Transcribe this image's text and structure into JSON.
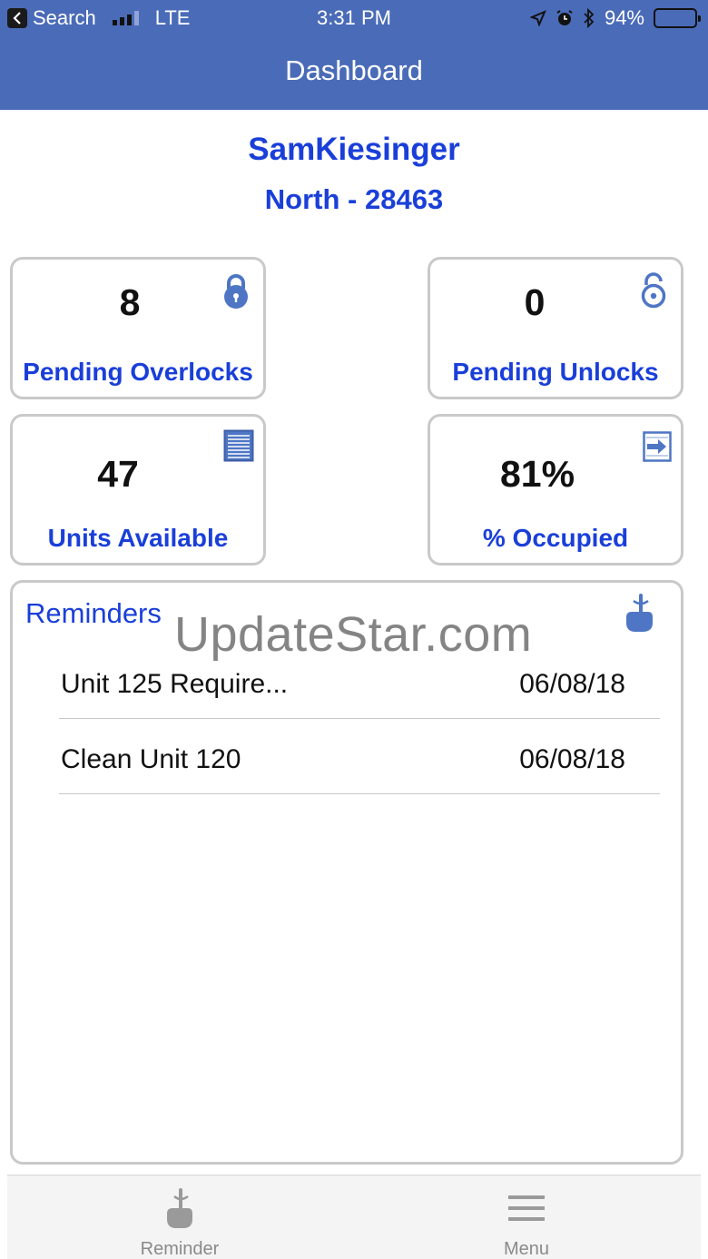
{
  "status_bar": {
    "back_app": "Search",
    "network": "LTE",
    "time": "3:31 PM",
    "battery": "94%"
  },
  "header": {
    "title": "Dashboard"
  },
  "user": {
    "name": "SamKiesinger",
    "site": "North - 28463"
  },
  "cards": {
    "pending_overlocks": {
      "value": "8",
      "label": "Pending Overlocks",
      "icon": "locked-padlock-icon"
    },
    "pending_unlocks": {
      "value": "0",
      "label": "Pending Unlocks",
      "icon": "unlocked-padlock-icon"
    },
    "units_available": {
      "value": "47",
      "label": "Units Available",
      "icon": "storage-door-icon"
    },
    "occupied": {
      "value": "81%",
      "label": "% Occupied",
      "icon": "move-in-arrow-icon"
    }
  },
  "reminders": {
    "title": "Reminders",
    "icon": "finger-string-icon",
    "items": [
      {
        "text": "Unit 125 Require...",
        "date": "06/08/18"
      },
      {
        "text": "Clean Unit 120",
        "date": "06/08/18"
      }
    ]
  },
  "watermark": "UpdateStar.com",
  "tabbar": {
    "reminder_label": "Reminder",
    "menu_label": "Menu"
  },
  "colors": {
    "header_bg": "#4a6bb8",
    "accent_blue": "#1a3fd9",
    "icon_blue": "#4e76c4"
  }
}
